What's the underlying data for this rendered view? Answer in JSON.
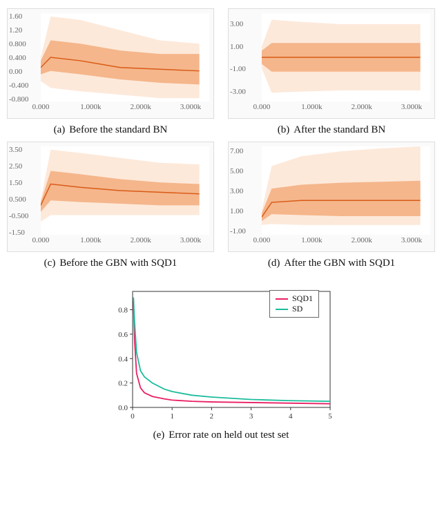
{
  "captions": {
    "a": {
      "tag": "(a)",
      "text": "Before the standard BN"
    },
    "b": {
      "tag": "(b)",
      "text": "After the standard BN"
    },
    "c": {
      "tag": "(c)",
      "text": "Before the GBN with SQD1"
    },
    "d": {
      "tag": "(d)",
      "text": "After the GBN with SQD1"
    },
    "e": {
      "tag": "(e)",
      "text": "Error rate on held out test set"
    }
  },
  "x_ticks_tb": [
    "0.000",
    "1.000k",
    "2.000k",
    "3.000k"
  ],
  "charts": {
    "a": {
      "y_ticks": [
        "1.60",
        "1.20",
        "0.800",
        "0.400",
        "0.00",
        "-0.400",
        "-0.800"
      ]
    },
    "b": {
      "y_ticks": [
        "3.00",
        "1.00",
        "-1.00",
        "-3.00"
      ]
    },
    "c": {
      "y_ticks": [
        "3.50",
        "2.50",
        "1.50",
        "0.500",
        "-0.500",
        "-1.50"
      ]
    },
    "d": {
      "y_ticks": [
        "7.00",
        "5.00",
        "3.00",
        "1.00",
        "-1.00"
      ]
    }
  },
  "line_chart": {
    "x_ticks": [
      "0",
      "1",
      "2",
      "3",
      "4",
      "5"
    ],
    "y_ticks": [
      "0.0",
      "0.2",
      "0.4",
      "0.6",
      "0.8"
    ],
    "legend": {
      "sqd1": "SQD1",
      "sd": "SD"
    }
  },
  "chart_data": [
    {
      "id": "a",
      "type": "area",
      "title": "Before the standard BN",
      "xlabel": "",
      "ylabel": "",
      "x_range": [
        0,
        3400
      ],
      "y_range": [
        -0.9,
        1.7
      ],
      "percentile_bands_at_steps": {
        "x": [
          0,
          200,
          800,
          1600,
          2400,
          3200
        ],
        "p95_hi": [
          0.4,
          1.6,
          1.5,
          1.2,
          0.9,
          0.8
        ],
        "p75_hi": [
          0.3,
          0.9,
          0.8,
          0.6,
          0.5,
          0.5
        ],
        "median": [
          0.1,
          0.4,
          0.3,
          0.1,
          0.05,
          0.0
        ],
        "p75_lo": [
          -0.1,
          0.0,
          -0.1,
          -0.25,
          -0.35,
          -0.4
        ],
        "p95_lo": [
          -0.3,
          -0.5,
          -0.6,
          -0.7,
          -0.8,
          -0.8
        ]
      }
    },
    {
      "id": "b",
      "type": "area",
      "title": "After the standard BN",
      "xlabel": "",
      "ylabel": "",
      "x_range": [
        0,
        3400
      ],
      "y_range": [
        -4.0,
        4.0
      ],
      "percentile_bands_at_steps": {
        "x": [
          0,
          200,
          800,
          1600,
          2400,
          3200
        ],
        "p95_hi": [
          1.0,
          3.4,
          3.2,
          3.0,
          3.0,
          3.0
        ],
        "p75_hi": [
          0.6,
          1.3,
          1.3,
          1.3,
          1.3,
          1.3
        ],
        "median": [
          0.0,
          0.0,
          0.0,
          0.0,
          0.0,
          0.0
        ],
        "p75_lo": [
          -0.6,
          -1.3,
          -1.3,
          -1.3,
          -1.3,
          -1.3
        ],
        "p95_lo": [
          -1.0,
          -3.2,
          -3.1,
          -3.0,
          -3.0,
          -3.0
        ]
      }
    },
    {
      "id": "c",
      "type": "area",
      "title": "Before the GBN with SQD1",
      "xlabel": "",
      "ylabel": "",
      "x_range": [
        0,
        3400
      ],
      "y_range": [
        -1.7,
        3.7
      ],
      "percentile_bands_at_steps": {
        "x": [
          0,
          200,
          800,
          1600,
          2400,
          3200
        ],
        "p95_hi": [
          0.4,
          3.5,
          3.3,
          3.0,
          2.7,
          2.6
        ],
        "p75_hi": [
          0.3,
          2.2,
          2.0,
          1.7,
          1.5,
          1.4
        ],
        "median": [
          0.1,
          1.4,
          1.2,
          1.0,
          0.9,
          0.8
        ],
        "p75_lo": [
          -0.3,
          0.4,
          0.3,
          0.2,
          0.1,
          0.1
        ],
        "p95_lo": [
          -0.9,
          -0.5,
          -0.5,
          -0.5,
          -0.5,
          -0.5
        ]
      }
    },
    {
      "id": "d",
      "type": "area",
      "title": "After the GBN with SQD1",
      "xlabel": "",
      "ylabel": "",
      "x_range": [
        0,
        3400
      ],
      "y_range": [
        -1.5,
        7.5
      ],
      "percentile_bands_at_steps": {
        "x": [
          0,
          200,
          800,
          1600,
          2400,
          3200
        ],
        "p95_hi": [
          1.0,
          5.5,
          6.5,
          7.0,
          7.3,
          7.5
        ],
        "p75_hi": [
          0.7,
          3.2,
          3.6,
          3.8,
          3.9,
          4.0
        ],
        "median": [
          0.3,
          1.8,
          2.0,
          2.0,
          2.0,
          2.0
        ],
        "p75_lo": [
          -0.1,
          0.6,
          0.5,
          0.4,
          0.4,
          0.4
        ],
        "p95_lo": [
          -0.5,
          -0.4,
          -0.5,
          -0.5,
          -0.5,
          -0.5
        ]
      }
    },
    {
      "id": "e",
      "type": "line",
      "title": "Error rate on held out test set",
      "xlabel": "",
      "ylabel": "",
      "xlim": [
        0,
        5
      ],
      "ylim": [
        0.0,
        0.95
      ],
      "series": [
        {
          "name": "SQD1",
          "color": "#e91e63",
          "x": [
            0.02,
            0.05,
            0.1,
            0.2,
            0.3,
            0.5,
            0.8,
            1.0,
            1.5,
            2.0,
            3.0,
            4.0,
            5.0
          ],
          "y": [
            0.9,
            0.55,
            0.28,
            0.16,
            0.12,
            0.09,
            0.07,
            0.06,
            0.05,
            0.045,
            0.04,
            0.035,
            0.03
          ]
        },
        {
          "name": "SD",
          "color": "#1abc9c",
          "x": [
            0.02,
            0.05,
            0.1,
            0.2,
            0.3,
            0.5,
            0.8,
            1.0,
            1.5,
            2.0,
            3.0,
            4.0,
            5.0
          ],
          "y": [
            0.9,
            0.7,
            0.45,
            0.3,
            0.25,
            0.2,
            0.15,
            0.13,
            0.1,
            0.085,
            0.065,
            0.055,
            0.05
          ]
        }
      ]
    }
  ]
}
